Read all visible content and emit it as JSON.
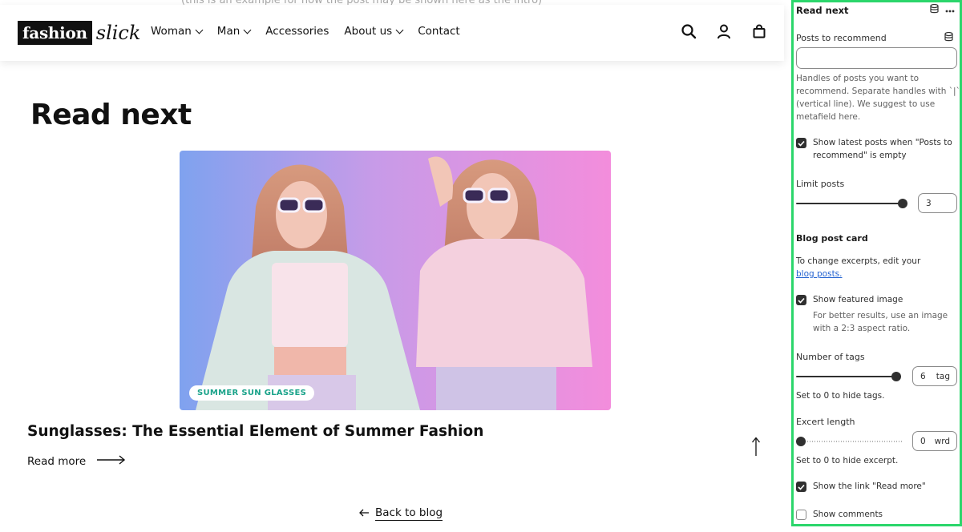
{
  "preview": {
    "ghost_text": "(this is an example for how the post may be shown here as the intro)",
    "logo": {
      "box_text": "fashion",
      "script_text": "slick"
    },
    "nav": [
      "Woman",
      "Man",
      "Accessories",
      "About us",
      "Contact"
    ],
    "nav_dropdowns": [
      true,
      true,
      false,
      true,
      false
    ],
    "icons": [
      "search-icon",
      "account-icon",
      "cart-icon"
    ],
    "page_title": "Read next",
    "post": {
      "tag": "SUMMER SUN GLASSES",
      "title": "Sunglasses: The Essential Element of Summer Fashion",
      "read_more": "Read more"
    },
    "back_to_blog": "Back to blog"
  },
  "panel": {
    "title": "Read next",
    "posts_to_recommend": {
      "label": "Posts to recommend",
      "value": "",
      "help": "Handles of posts you want to recommend. Separate handles with `|` (vertical line). We suggest to use metafield here."
    },
    "show_latest": {
      "label": "Show latest posts when \"Posts to recommend\" is empty",
      "checked": true
    },
    "limit_posts": {
      "label": "Limit posts",
      "value": "3",
      "fill": 1.0
    },
    "blog_post_card": {
      "title": "Blog post card",
      "help_prefix": "To change excerpts, edit your",
      "help_link": "blog posts."
    },
    "show_featured_image": {
      "label": "Show featured image",
      "help": "For better results, use an image with a 2:3 aspect ratio.",
      "checked": true
    },
    "number_of_tags": {
      "label": "Number of tags",
      "value": "6",
      "unit": "tag",
      "fill": 1.0,
      "help": "Set to 0 to hide tags."
    },
    "excerpt_length": {
      "label": "Excert length",
      "value": "0",
      "unit": "wrd",
      "fill": 0.0,
      "help": "Set to 0 to hide excerpt."
    },
    "show_read_more": {
      "label": "Show the link \"Read more\"",
      "checked": true
    },
    "show_comments": {
      "label": "Show comments",
      "checked": false
    }
  },
  "colors": {
    "panel_border": "#2bd66b",
    "tag_text": "#1aa38a",
    "link": "#2463d1"
  }
}
